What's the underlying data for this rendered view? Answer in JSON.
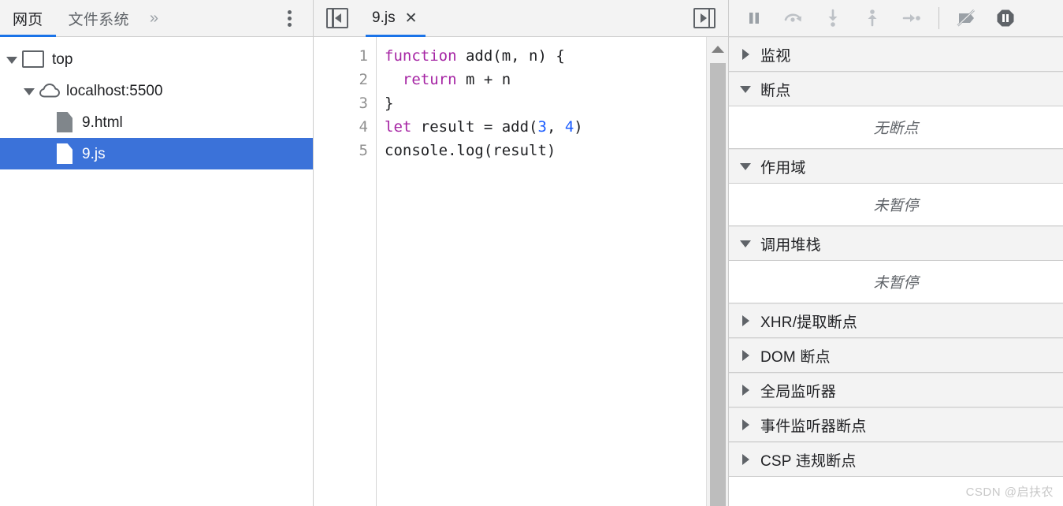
{
  "navigator": {
    "tabs": [
      {
        "label": "网页",
        "active": true,
        "name": "tab-page"
      },
      {
        "label": "文件系统",
        "active": false,
        "name": "tab-filesystem"
      }
    ],
    "overflow_label": "»",
    "menu_icon": "more-vertical-icon",
    "tree": [
      {
        "label": "top",
        "icon": "frame-icon",
        "level": 0,
        "twisty": "open",
        "selected": false
      },
      {
        "label": "localhost:5500",
        "icon": "cloud-icon",
        "level": 1,
        "twisty": "open",
        "selected": false
      },
      {
        "label": "9.html",
        "icon": "document-icon",
        "level": 2,
        "twisty": "none",
        "selected": false
      },
      {
        "label": "9.js",
        "icon": "document-icon",
        "level": 2,
        "twisty": "none",
        "selected": true
      }
    ]
  },
  "editor": {
    "left_toggle_icon": "show-navigator-left-icon",
    "right_toggle_icon": "show-navigator-right-icon",
    "tab": {
      "label": "9.js",
      "close_label": "✕",
      "active": true
    },
    "line_numbers": [
      "1",
      "2",
      "3",
      "4",
      "5"
    ],
    "code_lines": [
      [
        {
          "t": "function",
          "c": "kw"
        },
        {
          "t": " add(m, n) {",
          "c": "plain"
        }
      ],
      [
        {
          "t": "  ",
          "c": "plain"
        },
        {
          "t": "return",
          "c": "kw"
        },
        {
          "t": " m + n",
          "c": "plain"
        }
      ],
      [
        {
          "t": "}",
          "c": "plain"
        }
      ],
      [
        {
          "t": "let",
          "c": "kw"
        },
        {
          "t": " result = add(",
          "c": "plain"
        },
        {
          "t": "3",
          "c": "num"
        },
        {
          "t": ", ",
          "c": "plain"
        },
        {
          "t": "4",
          "c": "num"
        },
        {
          "t": ")",
          "c": "plain"
        }
      ],
      [
        {
          "t": "console.log(result)",
          "c": "plain"
        }
      ]
    ],
    "scrollbar": {
      "up_arrow_icon": "scroll-up-arrow-icon"
    }
  },
  "debugger": {
    "toolbar": [
      {
        "name": "resume-pause-button",
        "icon": "pause-icon",
        "title": "暂停"
      },
      {
        "name": "step-over-button",
        "icon": "step-over-icon",
        "title": "跳过下一个函数调用"
      },
      {
        "name": "step-into-button",
        "icon": "step-into-icon",
        "title": "单步调试进入下一个函数调用"
      },
      {
        "name": "step-out-button",
        "icon": "step-out-icon",
        "title": "从当前函数中跳出"
      },
      {
        "name": "step-button",
        "icon": "step-icon",
        "title": "单步调试"
      },
      {
        "name": "deactivate-breakpoints-button",
        "icon": "deactivate-breakpoints-icon",
        "title": "停用断点"
      },
      {
        "name": "pause-on-exceptions-button",
        "icon": "pause-on-exceptions-icon",
        "title": "出现异常时暂停"
      }
    ],
    "sections": [
      {
        "title": "监视",
        "state": "collapsed",
        "body": null
      },
      {
        "title": "断点",
        "state": "expanded",
        "body": "无断点"
      },
      {
        "title": "作用域",
        "state": "expanded",
        "body": "未暂停"
      },
      {
        "title": "调用堆栈",
        "state": "expanded",
        "body": "未暂停"
      },
      {
        "title": "XHR/提取断点",
        "state": "collapsed",
        "body": null
      },
      {
        "title": "DOM 断点",
        "state": "collapsed",
        "body": null
      },
      {
        "title": "全局监听器",
        "state": "collapsed",
        "body": null
      },
      {
        "title": "事件监听器断点",
        "state": "collapsed",
        "body": null
      },
      {
        "title": "CSP 违规断点",
        "state": "collapsed",
        "body": null
      }
    ]
  },
  "watermark": "CSDN @启扶农",
  "colors": {
    "accent": "#1a73e8",
    "selection": "#3b72d9",
    "keyword": "#a625a4",
    "number": "#1a5cff",
    "header_bg": "#f3f3f3",
    "border": "#cdcdcd"
  }
}
